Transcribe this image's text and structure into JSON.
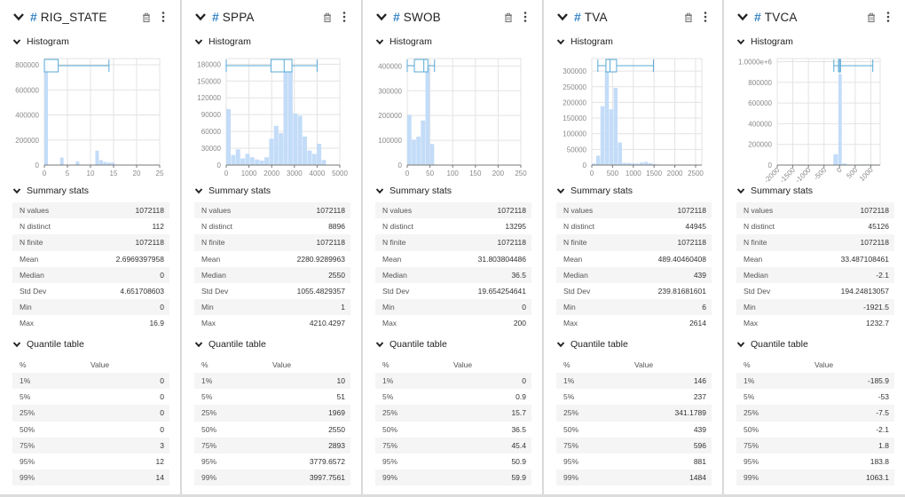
{
  "section_labels": {
    "histogram": "Histogram",
    "summary": "Summary stats",
    "quantile": "Quantile table",
    "quantile_col_pct": "%",
    "quantile_col_value": "Value"
  },
  "colors": {
    "accent": "#3a86c8",
    "bar_fill": "#c3dcf8",
    "boxplot_stroke": "#5aa9d6",
    "grid": "#e3e3e3"
  },
  "panels": [
    {
      "name": "RIG_STATE",
      "summary": [
        {
          "label": "N values",
          "value": "1072118"
        },
        {
          "label": "N distinct",
          "value": "112"
        },
        {
          "label": "N finite",
          "value": "1072118"
        },
        {
          "label": "Mean",
          "value": "2.6969397958"
        },
        {
          "label": "Median",
          "value": "0"
        },
        {
          "label": "Std Dev",
          "value": "4.651708603"
        },
        {
          "label": "Min",
          "value": "0"
        },
        {
          "label": "Max",
          "value": "16.9"
        }
      ],
      "quantiles": [
        {
          "pct": "1%",
          "value": "0"
        },
        {
          "pct": "5%",
          "value": "0"
        },
        {
          "pct": "25%",
          "value": "0"
        },
        {
          "pct": "50%",
          "value": "0"
        },
        {
          "pct": "75%",
          "value": "3"
        },
        {
          "pct": "95%",
          "value": "12"
        },
        {
          "pct": "99%",
          "value": "14"
        }
      ]
    },
    {
      "name": "SPPA",
      "summary": [
        {
          "label": "N values",
          "value": "1072118"
        },
        {
          "label": "N distinct",
          "value": "8896"
        },
        {
          "label": "N finite",
          "value": "1072118"
        },
        {
          "label": "Mean",
          "value": "2280.9289963"
        },
        {
          "label": "Median",
          "value": "2550"
        },
        {
          "label": "Std Dev",
          "value": "1055.4829357"
        },
        {
          "label": "Min",
          "value": "1"
        },
        {
          "label": "Max",
          "value": "4210.4297"
        }
      ],
      "quantiles": [
        {
          "pct": "1%",
          "value": "10"
        },
        {
          "pct": "5%",
          "value": "51"
        },
        {
          "pct": "25%",
          "value": "1969"
        },
        {
          "pct": "50%",
          "value": "2550"
        },
        {
          "pct": "75%",
          "value": "2893"
        },
        {
          "pct": "95%",
          "value": "3779.6572"
        },
        {
          "pct": "99%",
          "value": "3997.7561"
        }
      ]
    },
    {
      "name": "SWOB",
      "summary": [
        {
          "label": "N values",
          "value": "1072118"
        },
        {
          "label": "N distinct",
          "value": "13295"
        },
        {
          "label": "N finite",
          "value": "1072118"
        },
        {
          "label": "Mean",
          "value": "31.803804486"
        },
        {
          "label": "Median",
          "value": "36.5"
        },
        {
          "label": "Std Dev",
          "value": "19.654254641"
        },
        {
          "label": "Min",
          "value": "0"
        },
        {
          "label": "Max",
          "value": "200"
        }
      ],
      "quantiles": [
        {
          "pct": "1%",
          "value": "0"
        },
        {
          "pct": "5%",
          "value": "0.9"
        },
        {
          "pct": "25%",
          "value": "15.7"
        },
        {
          "pct": "50%",
          "value": "36.5"
        },
        {
          "pct": "75%",
          "value": "45.4"
        },
        {
          "pct": "95%",
          "value": "50.9"
        },
        {
          "pct": "99%",
          "value": "59.9"
        }
      ]
    },
    {
      "name": "TVA",
      "summary": [
        {
          "label": "N values",
          "value": "1072118"
        },
        {
          "label": "N distinct",
          "value": "44945"
        },
        {
          "label": "N finite",
          "value": "1072118"
        },
        {
          "label": "Mean",
          "value": "489.40460408"
        },
        {
          "label": "Median",
          "value": "439"
        },
        {
          "label": "Std Dev",
          "value": "239.81681601"
        },
        {
          "label": "Min",
          "value": "6"
        },
        {
          "label": "Max",
          "value": "2614"
        }
      ],
      "quantiles": [
        {
          "pct": "1%",
          "value": "146"
        },
        {
          "pct": "5%",
          "value": "237"
        },
        {
          "pct": "25%",
          "value": "341.1789"
        },
        {
          "pct": "50%",
          "value": "439"
        },
        {
          "pct": "75%",
          "value": "596"
        },
        {
          "pct": "95%",
          "value": "881"
        },
        {
          "pct": "99%",
          "value": "1484"
        }
      ]
    },
    {
      "name": "TVCA",
      "summary": [
        {
          "label": "N values",
          "value": "1072118"
        },
        {
          "label": "N distinct",
          "value": "45126"
        },
        {
          "label": "N finite",
          "value": "1072118"
        },
        {
          "label": "Mean",
          "value": "33.487108461"
        },
        {
          "label": "Median",
          "value": "-2.1"
        },
        {
          "label": "Std Dev",
          "value": "194.24813057"
        },
        {
          "label": "Min",
          "value": "-1921.5"
        },
        {
          "label": "Max",
          "value": "1232.7"
        }
      ],
      "quantiles": [
        {
          "pct": "1%",
          "value": "-185.9"
        },
        {
          "pct": "5%",
          "value": "-53"
        },
        {
          "pct": "25%",
          "value": "-7.5"
        },
        {
          "pct": "50%",
          "value": "-2.1"
        },
        {
          "pct": "75%",
          "value": "1.8"
        },
        {
          "pct": "95%",
          "value": "183.8"
        },
        {
          "pct": "99%",
          "value": "1063.1"
        }
      ]
    }
  ],
  "chart_data": [
    {
      "type": "bar",
      "title": "RIG_STATE histogram",
      "xlim": [
        0,
        25
      ],
      "ylim": [
        0,
        850000
      ],
      "xticks": [
        "0",
        "5",
        "10",
        "15",
        "20",
        "25"
      ],
      "xtick_values": [
        0,
        5,
        10,
        15,
        20,
        25
      ],
      "yticks": [
        "0",
        "200000",
        "400000",
        "600000",
        "800000"
      ],
      "ytick_values": [
        0,
        200000,
        400000,
        600000,
        800000
      ],
      "bins": [
        {
          "x0": 0,
          "x1": 0.85,
          "count": 820000
        },
        {
          "x0": 3.4,
          "x1": 4.25,
          "count": 60000
        },
        {
          "x0": 6.8,
          "x1": 7.65,
          "count": 30000
        },
        {
          "x0": 11.05,
          "x1": 11.9,
          "count": 115000
        },
        {
          "x0": 11.9,
          "x1": 12.75,
          "count": 40000
        },
        {
          "x0": 12.75,
          "x1": 13.6,
          "count": 25000
        },
        {
          "x0": 13.6,
          "x1": 14.45,
          "count": 20000
        },
        {
          "x0": 14.45,
          "x1": 15.3,
          "count": 20000
        }
      ],
      "boxplot": {
        "whisker_low": 0,
        "q1": 0,
        "median": 0,
        "q3": 3,
        "whisker_high": 14
      },
      "rotate_x_labels": false
    },
    {
      "type": "bar",
      "title": "SPPA histogram",
      "xlim": [
        0,
        5000
      ],
      "ylim": [
        0,
        190000
      ],
      "xticks": [
        "0",
        "1000",
        "2000",
        "3000",
        "4000",
        "5000"
      ],
      "xtick_values": [
        0,
        1000,
        2000,
        3000,
        4000,
        5000
      ],
      "yticks": [
        "0",
        "30000",
        "60000",
        "90000",
        "120000",
        "150000",
        "180000"
      ],
      "ytick_values": [
        0,
        30000,
        60000,
        90000,
        120000,
        150000,
        180000
      ],
      "bins": [
        {
          "x0": 0,
          "x1": 210,
          "count": 100000
        },
        {
          "x0": 210,
          "x1": 420,
          "count": 18000
        },
        {
          "x0": 420,
          "x1": 630,
          "count": 28000
        },
        {
          "x0": 630,
          "x1": 840,
          "count": 12000
        },
        {
          "x0": 840,
          "x1": 1050,
          "count": 20000
        },
        {
          "x0": 1050,
          "x1": 1260,
          "count": 14000
        },
        {
          "x0": 1260,
          "x1": 1470,
          "count": 10000
        },
        {
          "x0": 1470,
          "x1": 1680,
          "count": 8000
        },
        {
          "x0": 1680,
          "x1": 1890,
          "count": 14000
        },
        {
          "x0": 1890,
          "x1": 2100,
          "count": 47000
        },
        {
          "x0": 2100,
          "x1": 2310,
          "count": 70000
        },
        {
          "x0": 2310,
          "x1": 2520,
          "count": 57000
        },
        {
          "x0": 2520,
          "x1": 2730,
          "count": 168000
        },
        {
          "x0": 2730,
          "x1": 2940,
          "count": 168000
        },
        {
          "x0": 2940,
          "x1": 3150,
          "count": 92000
        },
        {
          "x0": 3150,
          "x1": 3360,
          "count": 88000
        },
        {
          "x0": 3360,
          "x1": 3570,
          "count": 51000
        },
        {
          "x0": 3570,
          "x1": 3780,
          "count": 26000
        },
        {
          "x0": 3780,
          "x1": 3990,
          "count": 20000
        },
        {
          "x0": 3990,
          "x1": 4200,
          "count": 38000
        },
        {
          "x0": 4200,
          "x1": 4410,
          "count": 9000
        }
      ],
      "boxplot": {
        "whisker_low": 0,
        "q1": 1969,
        "median": 2550,
        "q3": 2893,
        "whisker_high": 4000
      },
      "rotate_x_labels": false
    },
    {
      "type": "bar",
      "title": "SWOB histogram",
      "xlim": [
        0,
        250
      ],
      "ylim": [
        0,
        430000
      ],
      "xticks": [
        "0",
        "50",
        "100",
        "150",
        "200",
        "250"
      ],
      "xtick_values": [
        0,
        50,
        100,
        150,
        200,
        250
      ],
      "yticks": [
        "0",
        "100000",
        "200000",
        "300000",
        "400000"
      ],
      "ytick_values": [
        0,
        100000,
        200000,
        300000,
        400000
      ],
      "bins": [
        {
          "x0": 0,
          "x1": 10,
          "count": 203000
        },
        {
          "x0": 10,
          "x1": 20,
          "count": 103000
        },
        {
          "x0": 20,
          "x1": 30,
          "count": 115000
        },
        {
          "x0": 30,
          "x1": 40,
          "count": 180000
        },
        {
          "x0": 40,
          "x1": 50,
          "count": 395000
        },
        {
          "x0": 50,
          "x1": 60,
          "count": 85000
        },
        {
          "x0": 60,
          "x1": 70,
          "count": 2000
        }
      ],
      "boxplot": {
        "whisker_low": 0,
        "q1": 15.7,
        "median": 36.5,
        "q3": 45.4,
        "whisker_high": 60
      },
      "rotate_x_labels": false
    },
    {
      "type": "bar",
      "title": "TVA histogram",
      "xlim": [
        0,
        2650
      ],
      "ylim": [
        0,
        340000
      ],
      "xticks": [
        "0",
        "500",
        "1000",
        "1500",
        "2000",
        "2500"
      ],
      "xtick_values": [
        0,
        500,
        1000,
        1500,
        2000,
        2500
      ],
      "yticks": [
        "0",
        "50000",
        "100000",
        "150000",
        "200000",
        "250000",
        "300000"
      ],
      "ytick_values": [
        0,
        50000,
        100000,
        150000,
        200000,
        250000,
        300000
      ],
      "bins": [
        {
          "x0": 0,
          "x1": 105,
          "count": 5000
        },
        {
          "x0": 105,
          "x1": 210,
          "count": 30000
        },
        {
          "x0": 210,
          "x1": 315,
          "count": 188000
        },
        {
          "x0": 315,
          "x1": 420,
          "count": 300000
        },
        {
          "x0": 420,
          "x1": 525,
          "count": 178000
        },
        {
          "x0": 525,
          "x1": 630,
          "count": 246000
        },
        {
          "x0": 630,
          "x1": 735,
          "count": 72000
        },
        {
          "x0": 735,
          "x1": 840,
          "count": 7000
        },
        {
          "x0": 840,
          "x1": 945,
          "count": 7000
        },
        {
          "x0": 945,
          "x1": 1050,
          "count": 6000
        },
        {
          "x0": 1050,
          "x1": 1155,
          "count": 5000
        },
        {
          "x0": 1155,
          "x1": 1260,
          "count": 8000
        },
        {
          "x0": 1260,
          "x1": 1365,
          "count": 10000
        },
        {
          "x0": 1365,
          "x1": 1470,
          "count": 6000
        },
        {
          "x0": 1470,
          "x1": 1575,
          "count": 3000
        },
        {
          "x0": 1575,
          "x1": 1680,
          "count": 1500
        }
      ],
      "boxplot": {
        "whisker_low": 146,
        "q1": 341,
        "median": 439,
        "q3": 596,
        "whisker_high": 1484
      },
      "rotate_x_labels": false
    },
    {
      "type": "bar",
      "title": "TVCA histogram",
      "xlim": [
        -2000,
        1300
      ],
      "ylim": [
        0,
        1030000
      ],
      "xticks": [
        "-2000",
        "-1500",
        "-1000",
        "-500",
        "0",
        "500",
        "1000"
      ],
      "xtick_values": [
        -2000,
        -1500,
        -1000,
        -500,
        0,
        500,
        1000
      ],
      "yticks": [
        "0",
        "200000",
        "400000",
        "600000",
        "800000",
        "1.0000e+6"
      ],
      "ytick_values": [
        0,
        200000,
        400000,
        600000,
        800000,
        1000000
      ],
      "bins": [
        {
          "x0": -360,
          "x1": -200,
          "count": 3000
        },
        {
          "x0": -200,
          "x1": -40,
          "count": 105000
        },
        {
          "x0": -40,
          "x1": 80,
          "count": 880000
        },
        {
          "x0": 80,
          "x1": 240,
          "count": 15000
        },
        {
          "x0": 240,
          "x1": 560,
          "count": 3000
        },
        {
          "x0": 560,
          "x1": 1240,
          "count": 6000
        }
      ],
      "boxplot": {
        "whisker_low": -186,
        "q1": -7.5,
        "median": -2.1,
        "q3": 1.8,
        "whisker_high": 1063
      },
      "rotate_x_labels": true
    }
  ]
}
